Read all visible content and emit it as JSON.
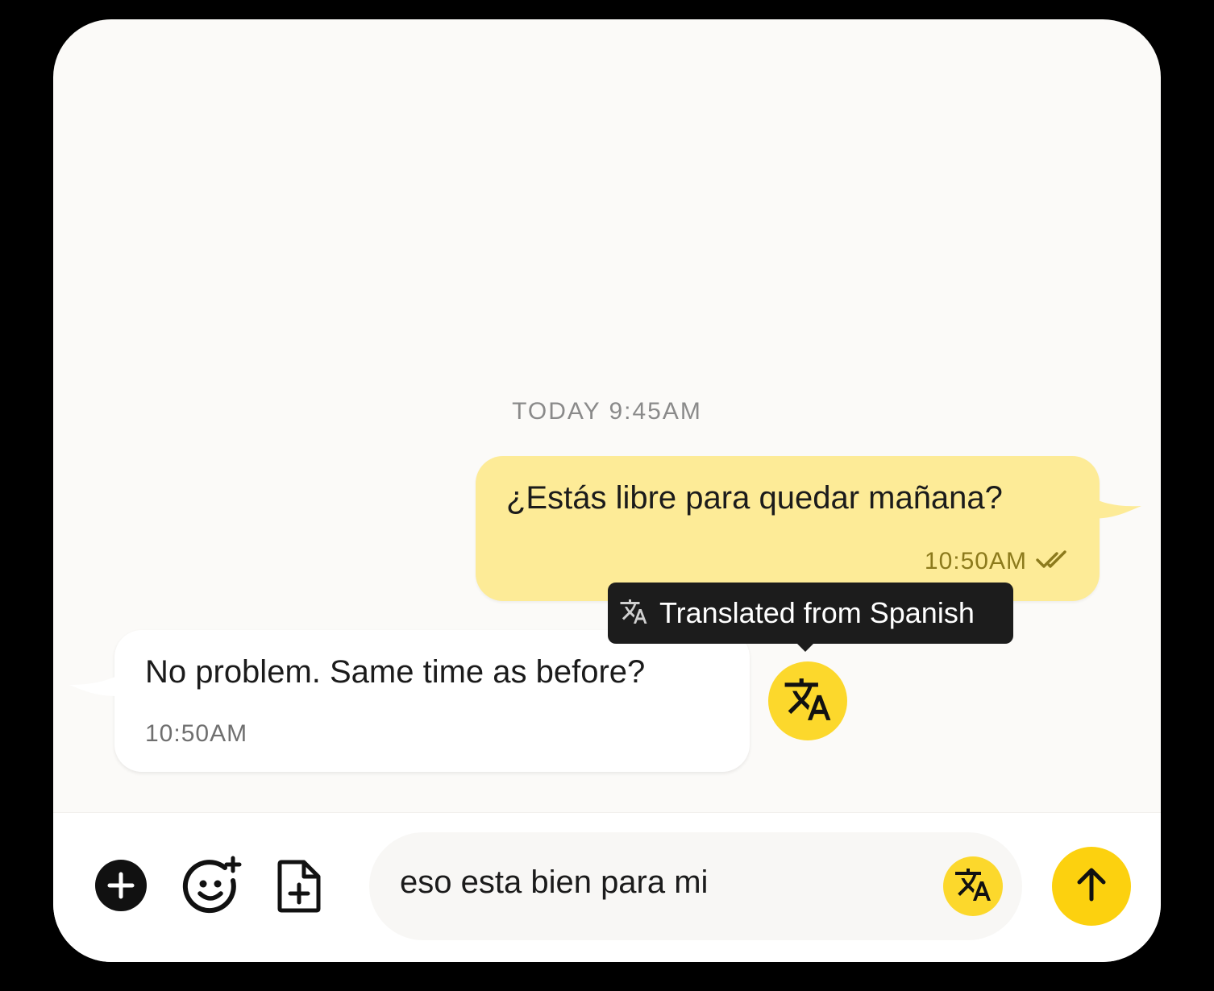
{
  "colors": {
    "background": "#fbfaf8",
    "outgoing_bubble": "#fdeb97",
    "incoming_bubble": "#ffffff",
    "accent_yellow": "#fcd82c",
    "tooltip": "#1c1c1c"
  },
  "conversation": {
    "divider": "TODAY 9:45AM",
    "messages": [
      {
        "direction": "outgoing",
        "text": "¿Estás libre para quedar mañana?",
        "time": "10:50AM",
        "status_icon": "double-check-icon"
      },
      {
        "direction": "incoming",
        "text": "No problem. Same time as before?",
        "time": "10:50AM"
      }
    ],
    "tooltip": {
      "icon": "translate-icon",
      "label": "Translated from Spanish"
    },
    "translate_button_icon": "translate-icon"
  },
  "composer": {
    "add_icon": "plus-circle-icon",
    "emoji_icon": "add-emoji-icon",
    "attach_icon": "file-add-icon",
    "input_value": "eso esta bien para mi",
    "translate_icon": "translate-icon",
    "send_icon": "arrow-up-icon"
  }
}
